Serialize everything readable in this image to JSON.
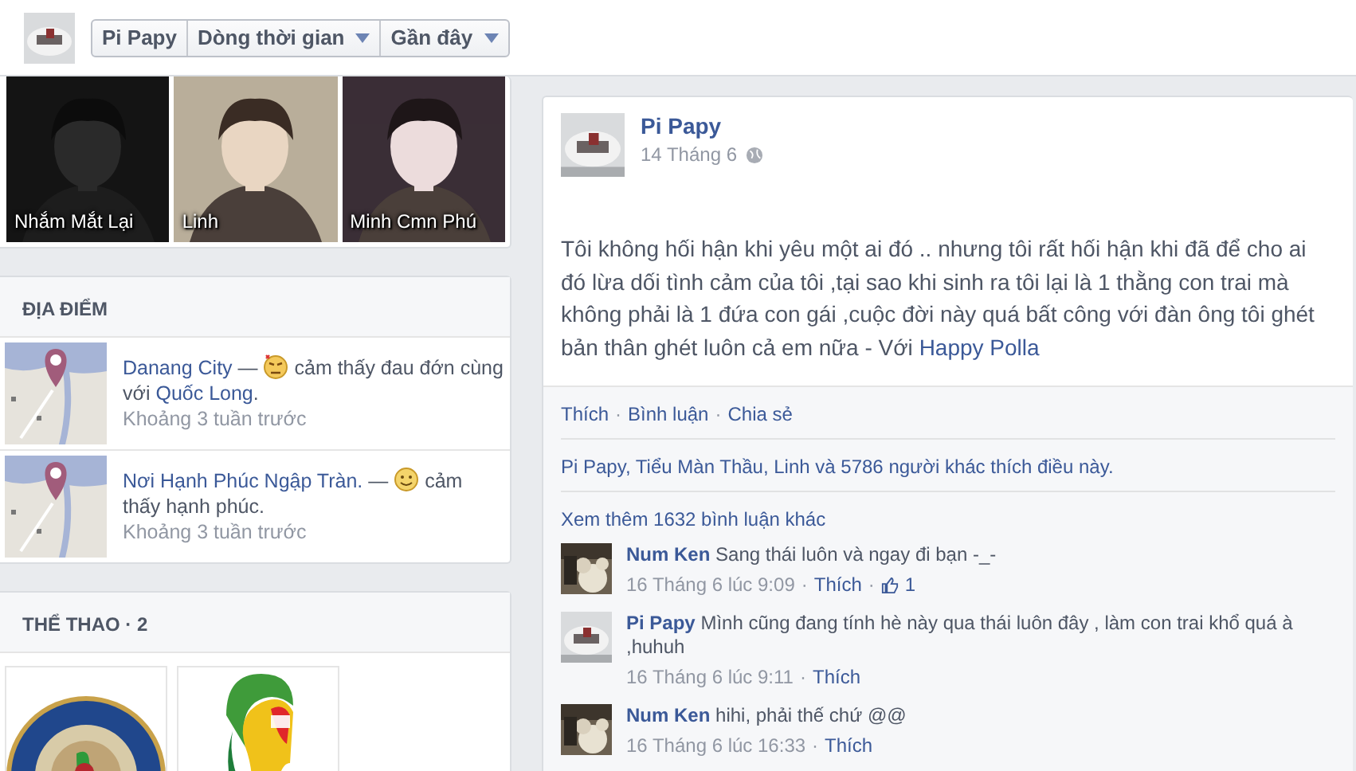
{
  "header": {
    "buttons": [
      {
        "label": "Pi Papy",
        "has_menu": false
      },
      {
        "label": "Dòng thời gian",
        "has_menu": true
      },
      {
        "label": "Gần đây",
        "has_menu": true
      }
    ]
  },
  "friends": [
    {
      "name": "Nhắm Mắt Lại"
    },
    {
      "name": "Linh"
    },
    {
      "name": "Minh Cmn Phú"
    }
  ],
  "places": {
    "title": "ĐỊA ĐIỂM",
    "items": [
      {
        "place": "Danang City",
        "dash": "—",
        "feeling": "cảm thấy đau đớn cùng với",
        "tagged": "Quốc Long",
        "end": ".",
        "time": "Khoảng 3 tuần trước"
      },
      {
        "place": "Nơi Hạnh Phúc Ngập Tràn.",
        "dash": "—",
        "feeling": "cảm thấy hạnh phúc.",
        "time": "Khoảng 3 tuần trước"
      }
    ]
  },
  "sports": {
    "title": "THỂ THAO · 2",
    "items": [
      {
        "kind": "badge"
      },
      {
        "kind": "trophy"
      }
    ]
  },
  "post": {
    "author": "Pi Papy",
    "date": "14 Tháng 6",
    "body": "Tôi không hối hận khi yêu một ai đó .. nhưng tôi rất hối hận khi đã để cho ai đó lừa dối tình cảm của tôi ,tại sao khi sinh ra tôi lại là 1 thằng con trai mà không phải là 1 đứa con gái ,cuộc đời này quá bất công với đàn ông tôi ghét bản thân ghét luôn cả em nữa - Với",
    "tagged": "Happy Polla",
    "separator": "·",
    "actions": [
      "Thích",
      "Bình luận",
      "Chia sẻ"
    ],
    "likes": "Pi Papy, Tiểu Màn Thầu, Linh và 5786 người khác thích điều này.",
    "more_comments": "Xem thêm 1632 bình luận khác",
    "comments": [
      {
        "author": "Num Ken",
        "text": "Sang thái luôn và ngay đi bạn -_-",
        "time": "16 Tháng 6 lúc 9:09",
        "like": "Thích",
        "like_count": "1"
      },
      {
        "author": "Pi Papy",
        "text": "Mình cũng đang tính hè này qua thái luôn đây , làm con trai khổ quá à ,huhuh",
        "time": "16 Tháng 6 lúc 9:11",
        "like": "Thích"
      },
      {
        "author": "Num Ken",
        "text": "hihi, phải thế chứ @@",
        "time": "16 Tháng 6 lúc 16:33",
        "like": "Thích"
      }
    ]
  }
}
